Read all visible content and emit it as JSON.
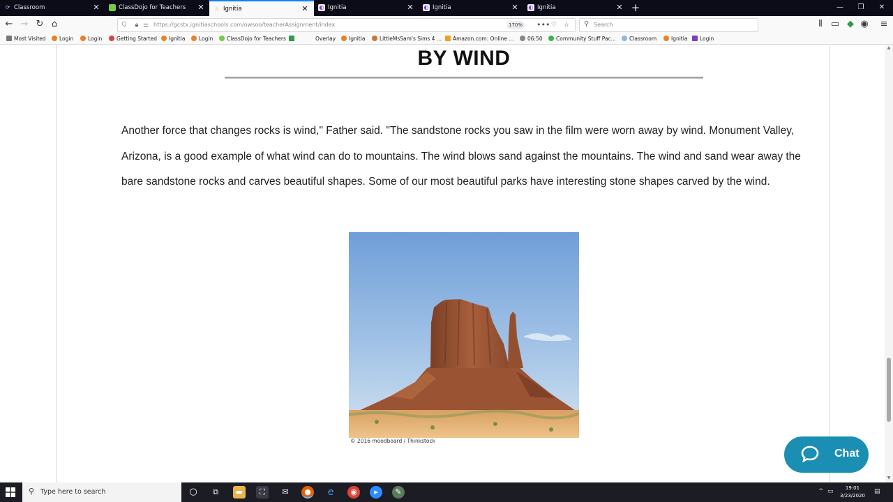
{
  "browser": {
    "tabs": [
      {
        "title": "Classroom",
        "active": false
      },
      {
        "title": "ClassDojo for Teachers",
        "active": false
      },
      {
        "title": "Ignitia",
        "active": true
      },
      {
        "title": "Ignitia",
        "active": false
      },
      {
        "title": "Ignitia",
        "active": false
      },
      {
        "title": "Ignitia",
        "active": false
      }
    ],
    "url": "https://gcstx.ignitiaschools.com/owsoo/teacherAssignment/index",
    "zoom": "170%",
    "search_placeholder": "Search",
    "bookmarks": [
      "Most Visited",
      "Login",
      "Login",
      "Getting Started",
      "Ignitia",
      "Login",
      "ClassDojo for Teachers",
      "Overlay",
      "Ignitia",
      "LittleMsSam's Sims 4 ...",
      "Amazon.com: Online ...",
      "06:50",
      "Community Stuff Pac...",
      "Classroom",
      "Ignitia",
      "Login"
    ]
  },
  "content": {
    "heading": "BY WIND",
    "paragraph": "Another force that changes rocks is wind,\" Father said. \"The sandstone rocks you saw in the film were worn away by wind. Monument Valley, Arizona, is a good example of what wind can do to mountains. The wind blows sand against the mountains. The wind and sand wear away the bare sandstone rocks and carves beautiful shapes. Some of our most beautiful parks have interesting stone shapes carved by the wind.",
    "image_credit": "© 2016 moodboard / Thinkstock",
    "chat_label": "Chat"
  },
  "taskbar": {
    "search_placeholder": "Type here to search",
    "time": "19:01",
    "date": "3/23/2020"
  },
  "colors": {
    "tabstrip": "#0c0c18",
    "active_tab_accent": "#0a84ff",
    "chat_button": "#1a8fb3",
    "taskbar": "#1c1c24"
  }
}
